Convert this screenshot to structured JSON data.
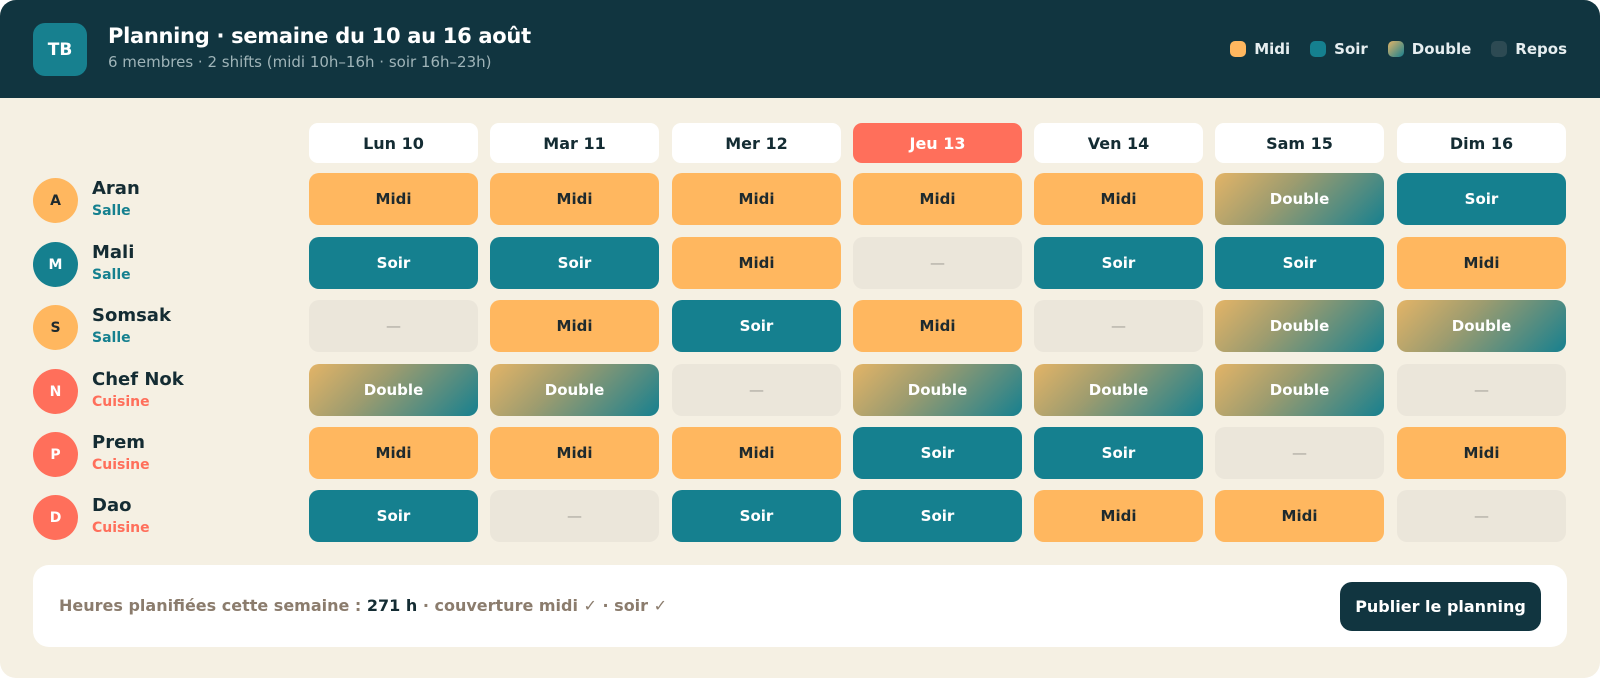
{
  "header": {
    "logo": "TB",
    "title": "Planning · semaine du 10 au 16 août",
    "subtitle": "6 membres · 2 shifts (midi 10h–16h · soir 16h–23h)"
  },
  "legend": [
    {
      "key": "midi",
      "label": "Midi",
      "color": "#ffb75f"
    },
    {
      "key": "soir",
      "label": "Soir",
      "color": "#15808f"
    },
    {
      "key": "double",
      "label": "Double",
      "color": "gradient #e3b467→#17808f"
    },
    {
      "key": "repos",
      "label": "Repos",
      "color": "#2d4a53"
    }
  ],
  "days": [
    {
      "label": "Lun 10",
      "today": false
    },
    {
      "label": "Mar 11",
      "today": false
    },
    {
      "label": "Mer 12",
      "today": false
    },
    {
      "label": "Jeu 13",
      "today": true
    },
    {
      "label": "Ven 14",
      "today": false
    },
    {
      "label": "Sam 15",
      "today": false
    },
    {
      "label": "Dim 16",
      "today": false
    }
  ],
  "shift_labels": {
    "midi": "Midi",
    "soir": "Soir",
    "double": "Double",
    "repos": "—"
  },
  "members": [
    {
      "initial": "A",
      "name": "Aran",
      "role": "Salle",
      "avatar_color": "#ffb75f",
      "shifts": [
        "midi",
        "midi",
        "midi",
        "midi",
        "midi",
        "double",
        "soir"
      ]
    },
    {
      "initial": "M",
      "name": "Mali",
      "role": "Salle",
      "avatar_color": "#15808f",
      "shifts": [
        "soir",
        "soir",
        "midi",
        "repos",
        "soir",
        "soir",
        "midi"
      ]
    },
    {
      "initial": "S",
      "name": "Somsak",
      "role": "Salle",
      "avatar_color": "#ffb75f",
      "shifts": [
        "repos",
        "midi",
        "soir",
        "midi",
        "repos",
        "double",
        "double"
      ]
    },
    {
      "initial": "N",
      "name": "Chef Nok",
      "role": "Cuisine",
      "avatar_color": "#ff6f5b",
      "shifts": [
        "double",
        "double",
        "repos",
        "double",
        "double",
        "double",
        "repos"
      ]
    },
    {
      "initial": "P",
      "name": "Prem",
      "role": "Cuisine",
      "avatar_color": "#ff6f5b",
      "shifts": [
        "midi",
        "midi",
        "midi",
        "soir",
        "soir",
        "repos",
        "midi"
      ]
    },
    {
      "initial": "D",
      "name": "Dao",
      "role": "Cuisine",
      "avatar_color": "#ff6f5b",
      "shifts": [
        "soir",
        "repos",
        "soir",
        "soir",
        "midi",
        "midi",
        "repos"
      ]
    }
  ],
  "role_colors": {
    "Salle": "#15808f",
    "Cuisine": "#ff6f5b"
  },
  "footer": {
    "prefix": "Heures planifiées cette semaine : ",
    "hours": "271 h",
    "suffix": " · couverture midi ✓ · soir ✓",
    "publish_label": "Publier le planning"
  }
}
